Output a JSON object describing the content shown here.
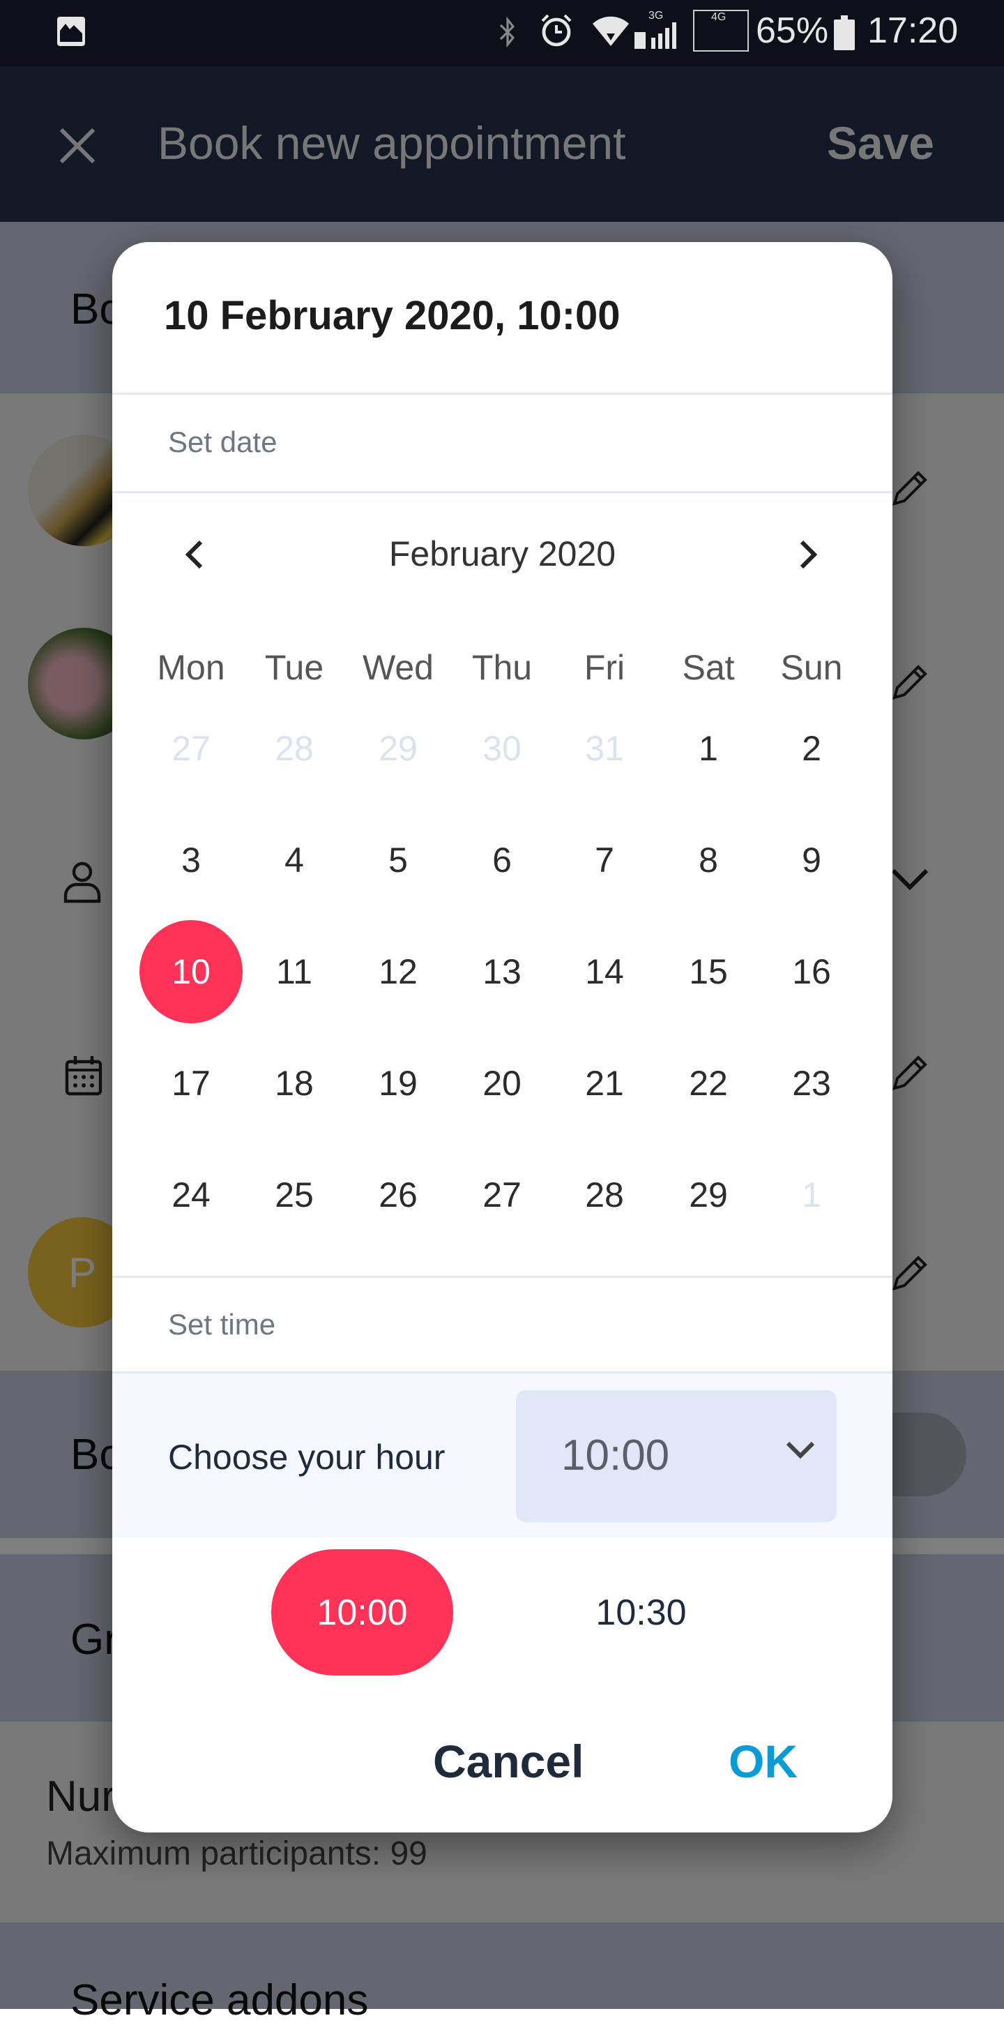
{
  "status_bar": {
    "battery": "65%",
    "time": "17:20",
    "network_1": "3G",
    "network_2": "4G",
    "icons": [
      "image-icon",
      "bluetooth-icon",
      "alarm-icon",
      "wifi-icon",
      "signal-icon",
      "battery-icon"
    ]
  },
  "app_bar": {
    "title": "Book new appointment",
    "save_label": "Save",
    "close_icon": "close-icon"
  },
  "background": {
    "section_1": "Bo",
    "section_2": "Bo",
    "section_3": "Gr",
    "participants_title": "Nur",
    "participants_subtitle": "Maximum participants: 99",
    "service_addons": "Service addons",
    "avatar_letter": "P"
  },
  "dialog": {
    "title": "10 February 2020, 10:00",
    "set_date_label": "Set date",
    "month_label": "February 2020",
    "weekdays": [
      "Mon",
      "Tue",
      "Wed",
      "Thu",
      "Fri",
      "Sat",
      "Sun"
    ],
    "weeks": [
      [
        {
          "d": "27",
          "muted": true
        },
        {
          "d": "28",
          "muted": true
        },
        {
          "d": "29",
          "muted": true
        },
        {
          "d": "30",
          "muted": true
        },
        {
          "d": "31",
          "muted": true
        },
        {
          "d": "1"
        },
        {
          "d": "2"
        }
      ],
      [
        {
          "d": "3"
        },
        {
          "d": "4"
        },
        {
          "d": "5"
        },
        {
          "d": "6"
        },
        {
          "d": "7"
        },
        {
          "d": "8"
        },
        {
          "d": "9"
        }
      ],
      [
        {
          "d": "10",
          "selected": true
        },
        {
          "d": "11"
        },
        {
          "d": "12"
        },
        {
          "d": "13"
        },
        {
          "d": "14"
        },
        {
          "d": "15"
        },
        {
          "d": "16"
        }
      ],
      [
        {
          "d": "17"
        },
        {
          "d": "18"
        },
        {
          "d": "19"
        },
        {
          "d": "20"
        },
        {
          "d": "21"
        },
        {
          "d": "22"
        },
        {
          "d": "23"
        }
      ],
      [
        {
          "d": "24"
        },
        {
          "d": "25"
        },
        {
          "d": "26"
        },
        {
          "d": "27"
        },
        {
          "d": "28"
        },
        {
          "d": "29"
        },
        {
          "d": "1",
          "muted": true
        }
      ]
    ],
    "set_time_label": "Set time",
    "hour_label": "Choose your hour",
    "hour_value": "10:00",
    "time_slots": [
      {
        "label": "10:00",
        "selected": true
      },
      {
        "label": "10:30",
        "selected": false
      }
    ],
    "cancel_label": "Cancel",
    "ok_label": "OK"
  },
  "colors": {
    "accent_selected": "#ff3358",
    "ok_button": "#0a9bd6",
    "cancel_button": "#1f2a3c",
    "select_bg": "#e1e7f6"
  }
}
